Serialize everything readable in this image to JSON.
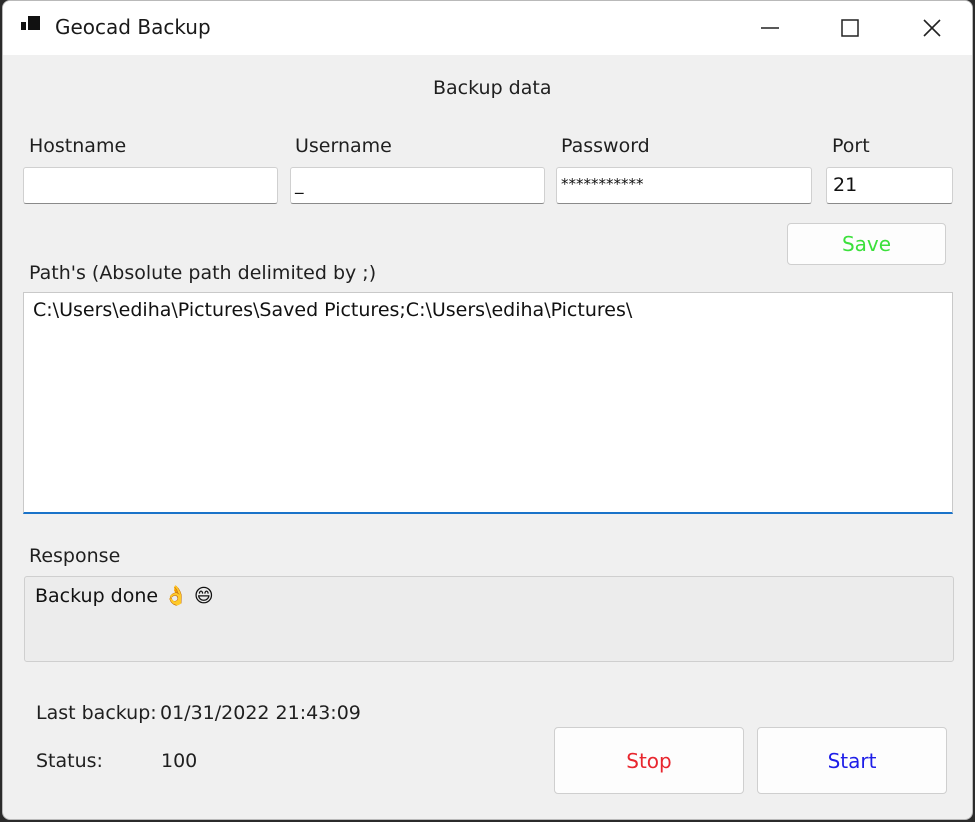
{
  "window": {
    "title": "Geocad Backup",
    "controls": {
      "minimize": "—",
      "maximize": "☐",
      "close": "✕"
    }
  },
  "heading": "Backup data",
  "fields": {
    "hostname": {
      "label": "Hostname",
      "value": ""
    },
    "username": {
      "label": "Username",
      "value": "_"
    },
    "password": {
      "label": "Password",
      "value": "***********"
    },
    "port": {
      "label": "Port",
      "value": "21"
    }
  },
  "save_button": {
    "label": "Save",
    "color": "#3be03b"
  },
  "paths": {
    "label": "Path's (Absolute path delimited by ;)",
    "value": "C:\\Users\\ediha\\Pictures\\Saved Pictures;C:\\Users\\ediha\\Pictures\\"
  },
  "response": {
    "label": "Response",
    "text": "Backup done 👌 😄"
  },
  "last_backup": {
    "label": "Last backup:",
    "value": "01/31/2022 21:43:09"
  },
  "status": {
    "label": "Status:",
    "value": "100"
  },
  "stop_button": {
    "label": "Stop",
    "color": "#e8262e"
  },
  "start_button": {
    "label": "Start",
    "color": "#1e1ee8"
  }
}
